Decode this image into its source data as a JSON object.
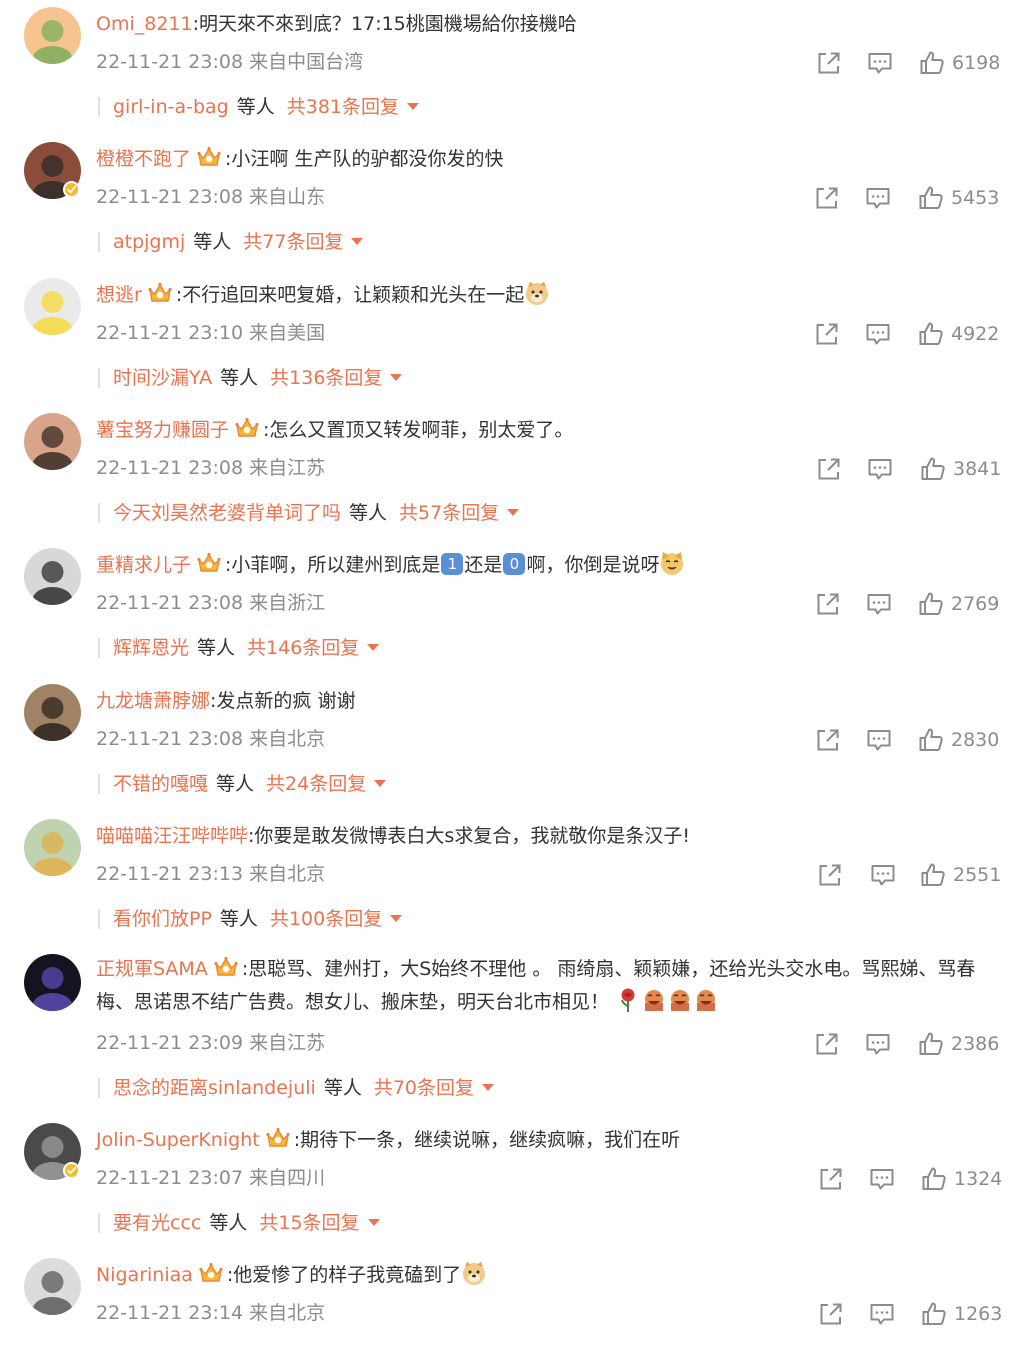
{
  "comments": [
    {
      "username": "Omi_8211",
      "crown": false,
      "verified": false,
      "text": ":明天來不來到底？17:15桃園機場給你接機哈",
      "time": "22-11-21 23:08",
      "location": "来自中国台湾",
      "likes": "6198",
      "reply_user": "girl-in-a-bag",
      "reply_et": "等人",
      "reply_count": "共381条回复",
      "avatar_bg": "#f6c58f",
      "avatar_fg": "#7cae5a"
    },
    {
      "username": "橙橙不跑了",
      "crown": true,
      "verified": true,
      "text": ":小汪啊 生产队的驴都没你发的快",
      "time": "22-11-21 23:08",
      "location": "来自山东",
      "likes": "5453",
      "reply_user": "atpjgmj",
      "reply_et": "等人",
      "reply_count": "共77条回复",
      "avatar_bg": "#8a4d3a",
      "avatar_fg": "#2f2a2a"
    },
    {
      "username": "想逃r",
      "crown": true,
      "verified": false,
      "text": ":不行追回来吧复婚，让颖颖和光头在一起",
      "emoji_end": "doge",
      "time": "22-11-21 23:10",
      "location": "来自美国",
      "likes": "4922",
      "reply_user": "时间沙漏YA",
      "reply_et": "等人",
      "reply_count": "共136条回复",
      "avatar_bg": "#eaeaea",
      "avatar_fg": "#f5d93c"
    },
    {
      "username": "薯宝努力赚圆子",
      "crown": true,
      "verified": false,
      "text": ":怎么又置顶又转发啊菲，别太爱了。",
      "time": "22-11-21 23:08",
      "location": "来自江苏",
      "likes": "3841",
      "reply_user": "今天刘昊然老婆背单词了吗",
      "reply_et": "等人",
      "reply_count": "共57条回复",
      "avatar_bg": "#d9a58a",
      "avatar_fg": "#3a2b25"
    },
    {
      "username": "重精求儿子",
      "crown": true,
      "verified": false,
      "text_a": ":小菲啊，所以建州到底是",
      "key1": "1",
      "text_b": "还是",
      "key2": "0",
      "text_c": "啊，你倒是说呀",
      "emoji_end": "dog",
      "time": "22-11-21 23:08",
      "location": "来自浙江",
      "likes": "2769",
      "reply_user": "辉辉恩光",
      "reply_et": "等人",
      "reply_count": "共146条回复",
      "avatar_bg": "#d8d8d8",
      "avatar_fg": "#2e2e2e"
    },
    {
      "username": "九龙塘萧脖娜",
      "crown": false,
      "verified": false,
      "text": ":发点新的疯 谢谢",
      "time": "22-11-21 23:08",
      "location": "来自北京",
      "likes": "2830",
      "reply_user": "不错的嘎嘎",
      "reply_et": "等人",
      "reply_count": "共24条回复",
      "avatar_bg": "#a08264",
      "avatar_fg": "#2d241d"
    },
    {
      "username": "喵喵喵汪汪哔哔哔",
      "crown": false,
      "verified": false,
      "text": ":你要是敢发微博表白大s求复合，我就敬你是条汉子!",
      "time": "22-11-21 23:13",
      "location": "来自北京",
      "likes": "2551",
      "reply_user": "看你们放PP",
      "reply_et": "等人",
      "reply_count": "共100条回复",
      "avatar_bg": "#bfd3b0",
      "avatar_fg": "#e0b04a"
    },
    {
      "username": "正规軍SAMA",
      "crown": true,
      "verified": false,
      "text": ":思聪骂、建州打，大S始终不理他 。 雨绮扇、颖颖嫌，还给光头交水电。骂熙娣、骂春梅、思诺思不结广告费。想女儿、搬床垫，明天台北市相见！",
      "emoji_end": "rose-laughs",
      "time": "22-11-21 23:09",
      "location": "来自江苏",
      "likes": "2386",
      "reply_user": "思念的距离sinlandejuli",
      "reply_et": "等人",
      "reply_count": "共70条回复",
      "avatar_bg": "#141420",
      "avatar_fg": "#5b4ab4"
    },
    {
      "username": "Jolin-SuperKnight",
      "crown": true,
      "verified": true,
      "text": ":期待下一条，继续说嘛，继续疯嘛，我们在听",
      "time": "22-11-21 23:07",
      "location": "来自四川",
      "likes": "1324",
      "reply_user": "要有光ccc",
      "reply_et": "等人",
      "reply_count": "共15条回复",
      "avatar_bg": "#4a4a4a",
      "avatar_fg": "#9e9e9e"
    },
    {
      "username": "Nigariniaa",
      "crown": true,
      "verified": false,
      "text": ":他爱惨了的样子我竟磕到了",
      "emoji_end": "doge",
      "time": "22-11-21 23:14",
      "location": "来自北京",
      "likes": "1263",
      "reply_user": "",
      "reply_et": "",
      "reply_count": "",
      "avatar_bg": "#dcdcdc",
      "avatar_fg": "#5a5a5a"
    }
  ],
  "colors": {
    "username": "#eb7350",
    "meta": "#8c8c8c",
    "text": "#333333",
    "icon": "#8c8c8c"
  },
  "icons": {
    "share": "share-icon",
    "comment": "comment-icon",
    "like": "like-icon",
    "crown": "crown-badge-icon",
    "verified": "verified-badge-icon",
    "expand": "chevron-down-icon"
  }
}
